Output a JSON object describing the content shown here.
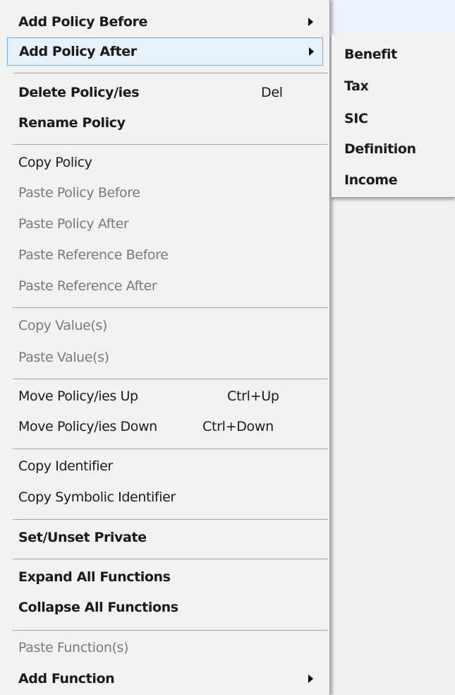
{
  "menu": {
    "items": [
      {
        "label": "Add Policy Before",
        "shortcut": "",
        "submenu": true,
        "enabled": true,
        "bold": true
      },
      {
        "label": "Add Policy After",
        "shortcut": "",
        "submenu": true,
        "enabled": true,
        "bold": true,
        "highlighted": true
      },
      {
        "label": "Delete Policy/ies",
        "shortcut": "Del",
        "enabled": true,
        "bold": true
      },
      {
        "label": "Rename Policy",
        "shortcut": "",
        "enabled": true,
        "bold": true
      },
      {
        "label": "Copy Policy",
        "shortcut": "",
        "enabled": true,
        "bold": false
      },
      {
        "label": "Paste Policy Before",
        "shortcut": "",
        "enabled": false
      },
      {
        "label": "Paste Policy After",
        "shortcut": "",
        "enabled": false
      },
      {
        "label": "Paste Reference Before",
        "shortcut": "",
        "enabled": false
      },
      {
        "label": "Paste Reference After",
        "shortcut": "",
        "enabled": false
      },
      {
        "label": "Copy Value(s)",
        "shortcut": "",
        "enabled": false
      },
      {
        "label": "Paste Value(s)",
        "shortcut": "",
        "enabled": false
      },
      {
        "label": "Move Policy/ies Up",
        "shortcut": "Ctrl+Up",
        "enabled": true,
        "bold": false
      },
      {
        "label": "Move Policy/ies Down",
        "shortcut": "Ctrl+Down",
        "enabled": true,
        "bold": false
      },
      {
        "label": "Copy Identifier",
        "shortcut": "",
        "enabled": true,
        "bold": false
      },
      {
        "label": "Copy Symbolic Identifier",
        "shortcut": "",
        "enabled": true,
        "bold": false
      },
      {
        "label": "Set/Unset Private",
        "shortcut": "",
        "enabled": true,
        "bold": true
      },
      {
        "label": "Expand All Functions",
        "shortcut": "",
        "enabled": true,
        "bold": true
      },
      {
        "label": "Collapse All Functions",
        "shortcut": "",
        "enabled": true,
        "bold": true
      },
      {
        "label": "Paste Function(s)",
        "shortcut": "",
        "enabled": false
      },
      {
        "label": "Add Function",
        "shortcut": "",
        "submenu": true,
        "enabled": true,
        "bold": true
      }
    ]
  },
  "submenu": {
    "parent": "Add Policy After",
    "items": [
      {
        "label": "Benefit"
      },
      {
        "label": "Tax"
      },
      {
        "label": "SIC"
      },
      {
        "label": "Definition"
      },
      {
        "label": "Income"
      }
    ]
  },
  "colors": {
    "menu_background": "#f2f2f2",
    "highlight_background": "#e5f1fb",
    "highlight_border": "#6fb1e6",
    "disabled_text": "#7a7a7a",
    "separator": "#a8a8a8"
  }
}
